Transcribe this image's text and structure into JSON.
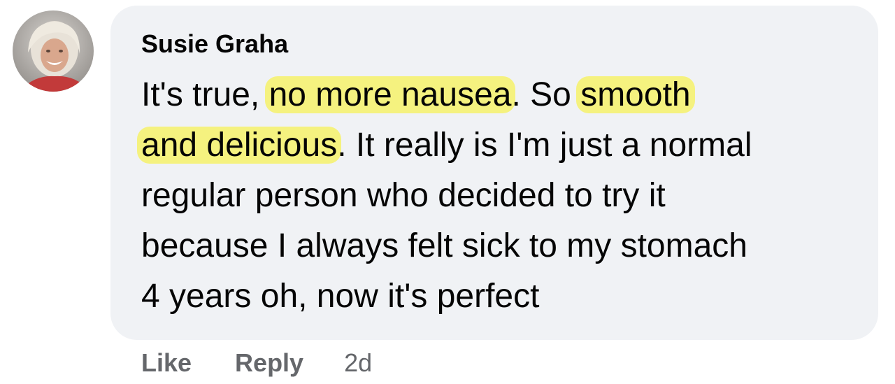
{
  "comment": {
    "author": "Susie Graha",
    "avatar_icon": "user-avatar",
    "highlight_color": "#f5f27f",
    "bubble_color": "#f0f2f5",
    "lines": [
      {
        "before": "It's true, ",
        "hl1": "no more nausea",
        "mid": ". So ",
        "hl2": "smooth"
      },
      {
        "hl": "and delicious",
        "after": ". It really is I'm just a normal"
      },
      {
        "text": "regular person who decided to try it"
      },
      {
        "text": "because I always felt sick to my stomach"
      },
      {
        "text": "4 years oh, now it's perfect"
      }
    ]
  },
  "actions": {
    "like": "Like",
    "reply": "Reply",
    "timestamp": "2d"
  }
}
